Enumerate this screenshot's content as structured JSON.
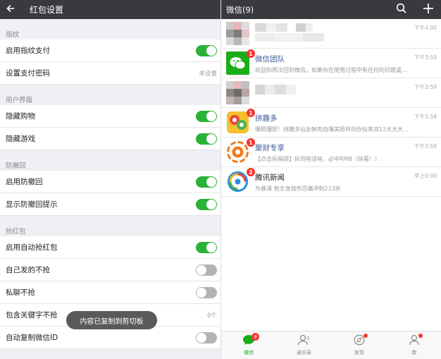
{
  "left": {
    "header": {
      "back_icon": "arrow-left-icon",
      "title": "红包设置"
    },
    "sections": {
      "fingerprint": {
        "label": "指纹",
        "rows": [
          {
            "label": "启用指纹支付",
            "toggle": true
          },
          {
            "label": "设置支付密码",
            "value": "未设置"
          }
        ]
      },
      "ui": {
        "label": "用户界面",
        "rows": [
          {
            "label": "隐藏购物",
            "toggle": true
          },
          {
            "label": "隐藏游戏",
            "toggle": true
          }
        ]
      },
      "recall": {
        "label": "防撤回",
        "rows": [
          {
            "label": "启用防撤回",
            "toggle": true
          },
          {
            "label": "显示防撤回提示",
            "toggle": true
          }
        ]
      },
      "redpacket": {
        "label": "抢红包",
        "rows": [
          {
            "label": "启用自动抢红包",
            "toggle": true
          },
          {
            "label": "自己发的不抢",
            "toggle": false
          },
          {
            "label": "私聊不抢",
            "toggle": false
          },
          {
            "label": "包含关键字不抢",
            "value": "0个"
          },
          {
            "label": "自动复制微信ID",
            "toggle": false
          }
        ]
      }
    },
    "toast": "内容已复制到剪切板"
  },
  "right": {
    "header": {
      "title": "微信(9)",
      "search_icon": "search-icon",
      "add_icon": "plus-icon"
    },
    "chats": [
      {
        "name": "",
        "preview": "",
        "time": "下午4:00",
        "badge": "",
        "avatar": "blurred"
      },
      {
        "name": "微信团队",
        "preview": "欢迎你再次回到微信。如果你在使用过程中有任何的问题或...",
        "time": "下午3:59",
        "badge": "1",
        "avatar": "wechat-team"
      },
      {
        "name": "",
        "preview": "",
        "time": "下午3:59",
        "badge": "",
        "avatar": "blurred"
      },
      {
        "name": "拼趣多",
        "preview": "爆照爆照！拼趣多仙女鲜肉自爆美照并向你投来双12大大大...",
        "time": "下午3:58",
        "badge": "1",
        "avatar": "pinquduo"
      },
      {
        "name": "聚财专享",
        "preview": "【点击拆福袋】拆到啥送啥，必中RMB（快看！）",
        "time": "下午3:58",
        "badge": "1",
        "avatar": "jucai"
      },
      {
        "name": "腾讯新闻",
        "preview": "为暴涌 他全身烧伤忍痛冲刺213米",
        "time": "早上9:00",
        "badge": "2",
        "avatar": "tencent-news"
      }
    ],
    "tabbar": [
      {
        "label": "微信",
        "icon": "chat-bubble-icon",
        "badge": "9",
        "dot": false,
        "active": true
      },
      {
        "label": "通讯录",
        "icon": "contacts-icon",
        "badge": "",
        "dot": false,
        "active": false
      },
      {
        "label": "发现",
        "icon": "compass-icon",
        "badge": "",
        "dot": true,
        "active": false
      },
      {
        "label": "我",
        "icon": "person-icon",
        "badge": "",
        "dot": true,
        "active": false
      }
    ]
  },
  "colors": {
    "accent": "#2bb138",
    "header": "#393a3f",
    "badge": "#f43530",
    "link_name": "#3b5998"
  }
}
